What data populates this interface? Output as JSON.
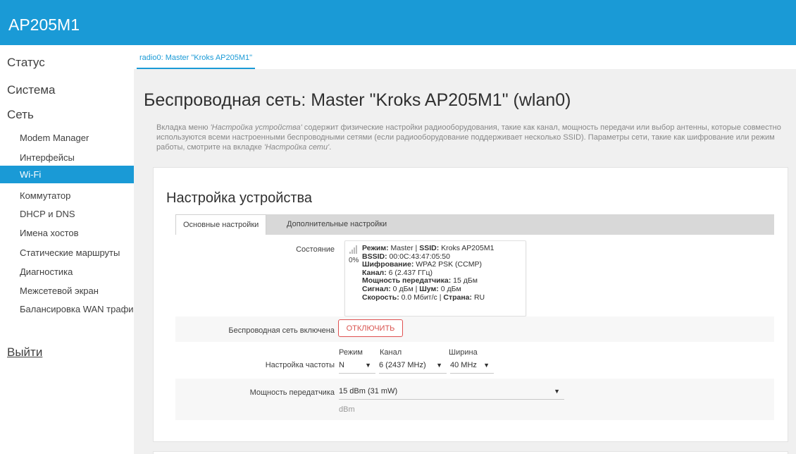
{
  "app": {
    "title": "AP205M1"
  },
  "sidebar": {
    "top_items": [
      "Статус",
      "Система",
      "Сеть"
    ],
    "sub_items": [
      "Modem Manager",
      "Интерфейсы",
      "Wi-Fi",
      "Коммутатор",
      "DHCP и DNS",
      "Имена хостов",
      "Статические маршруты",
      "Диагностика",
      "Межсетевой экран",
      "Балансировка WAN трафик"
    ],
    "active": "Wi-Fi",
    "logout": "Выйти"
  },
  "tabs": {
    "radio": "radio0: Master \"Kroks AP205M1\""
  },
  "page": {
    "title": "Беспроводная сеть: Master \"Kroks AP205M1\" (wlan0)",
    "desc_1": "Вкладка меню ",
    "desc_em1": "'Настройка устройства'",
    "desc_2": " содержит физические настройки радиооборудования, такие как канал, мощность передачи или выбор антенны, которые совместно используются всеми настроенными беспроводными сетями (если радиооборудование поддерживает несколько SSID). Параметры сети, такие как шифрование или режим работы, смотрите на вкладке ",
    "desc_em2": "'Настройка сети'",
    "desc_3": "."
  },
  "device": {
    "title": "Настройка устройства",
    "tab_basic": "Основные настройки",
    "tab_advanced": "Дополнительные настройки",
    "status_label": "Состояние",
    "signal_pct": "0%",
    "status": {
      "mode_k": "Режим:",
      "mode_v": " Master | ",
      "ssid_k": "SSID:",
      "ssid_v": " Kroks AP205M1",
      "bssid_k": "BSSID:",
      "bssid_v": " 00:0C:43:47:05:50",
      "enc_k": "Шифрование:",
      "enc_v": " WPA2 PSK (CCMP)",
      "chan_k": "Канал:",
      "chan_v": " 6 (2.437 ГГц)",
      "pow_k": "Мощность передатчика:",
      "pow_v": " 15 дБм",
      "sig_k": "Сигнал:",
      "sig_v": " 0 дБм | ",
      "noise_k": "Шум:",
      "noise_v": " 0 дБм",
      "rate_k": "Скорость:",
      "rate_v": " 0.0 Мбит/с | ",
      "country_k": "Страна:",
      "country_v": " RU"
    },
    "enabled_label": "Беспроводная сеть включена",
    "disable_button": "ОТКЛЮЧИТЬ",
    "freq_label": "Настройка частоты",
    "mode_head": "Режим",
    "channel_head": "Канал",
    "width_head": "Ширина",
    "mode_value": "N",
    "channel_value": "6 (2437 MHz)",
    "width_value": "40 MHz",
    "power_label": "Мощность передатчика",
    "power_value": "15 dBm (31 mW)",
    "power_unit": "dBm"
  },
  "colors": {
    "accent": "#1a9ad6",
    "danger": "#d9534f"
  },
  "icons": {
    "dropdown": "triangle-down",
    "signal": "signal-bars"
  }
}
